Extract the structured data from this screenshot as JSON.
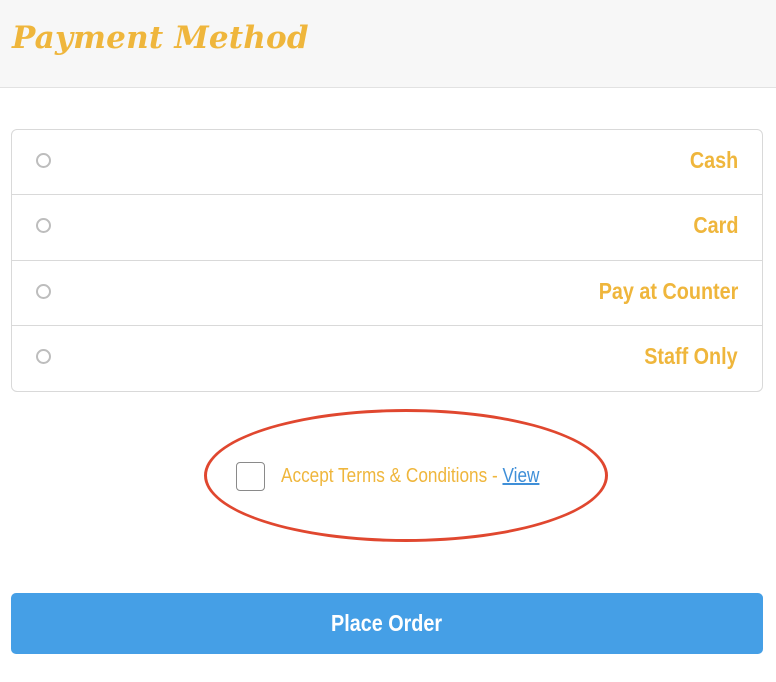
{
  "header": {
    "title": "Payment Method"
  },
  "payment_options": [
    {
      "label": "Cash",
      "selected": false
    },
    {
      "label": "Card",
      "selected": false
    },
    {
      "label": "Pay at Counter",
      "selected": false
    },
    {
      "label": "Staff Only",
      "selected": false
    }
  ],
  "terms": {
    "text": "Accept Terms & Conditions - ",
    "link": "View",
    "checked": false
  },
  "actions": {
    "place_order_label": "Place Order"
  },
  "colors": {
    "accent": "#efb63c",
    "button": "#459fe6",
    "link": "#3f8fd8",
    "highlight_ring": "#e0472f"
  },
  "icons": {
    "radio": "radio-unchecked-icon",
    "checkbox": "checkbox-unchecked-icon"
  }
}
